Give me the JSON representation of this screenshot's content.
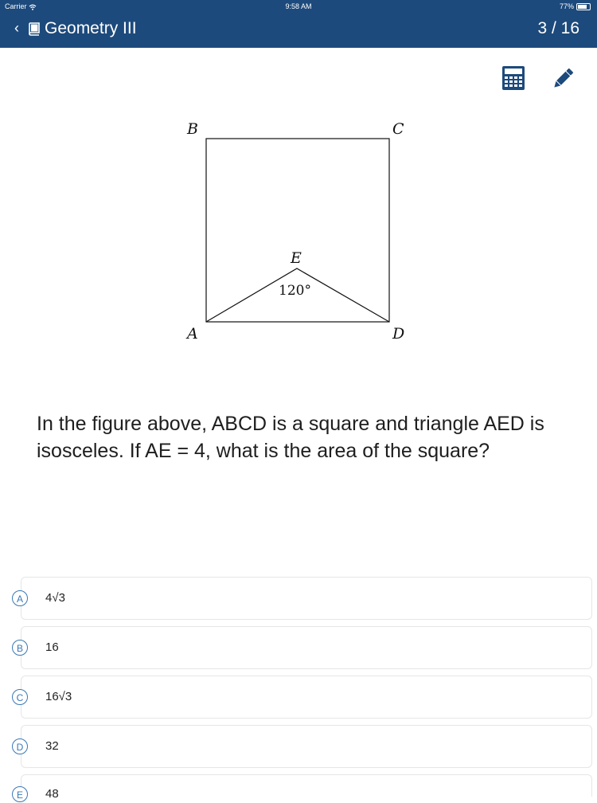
{
  "status": {
    "carrier": "Carrier",
    "time": "9:58 AM",
    "battery": "77%"
  },
  "nav": {
    "title": "Geometry III",
    "counter": "3 / 16"
  },
  "figure": {
    "labels": {
      "B": "B",
      "C": "C",
      "E": "E",
      "A": "A",
      "D": "D"
    },
    "angle": "120°"
  },
  "question": "In the figure above, ABCD is a square and triangle AED is isosceles. If AE = 4, what is the area of the square?",
  "choices": [
    {
      "letter": "A",
      "text": "4√3"
    },
    {
      "letter": "B",
      "text": "16"
    },
    {
      "letter": "C",
      "text": "16√3"
    },
    {
      "letter": "D",
      "text": "32"
    },
    {
      "letter": "E",
      "text": "48"
    }
  ],
  "colors": {
    "header": "#1d4a7c",
    "accent": "#3a78b5"
  },
  "icons": [
    "back-chevron-icon",
    "book-icon",
    "calculator-icon",
    "pencil-icon",
    "wifi-icon",
    "battery-icon"
  ]
}
